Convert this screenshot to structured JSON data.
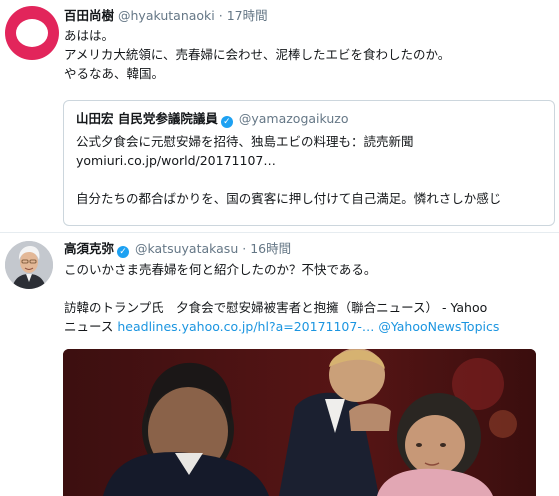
{
  "tweet1": {
    "name": "百田尚樹",
    "handle": "@hyakutanaoki",
    "separator": "·",
    "time": "17時間",
    "lines": [
      "あはは。",
      "アメリカ大統領に、売春婦に会わせ、泥棒したエビを食わしたのか。",
      "やるなあ、韓国。"
    ],
    "quote": {
      "name": "山田宏 自民党参議院議員",
      "handle": "@yamazogaikuzo",
      "line1": "公式夕食会に元慰安婦を招待、独島エビの料理も：読売新聞",
      "line2": "yomiuri.co.jp/world/20171107…",
      "line3": "自分たちの都合ばかりを、国の賓客に押し付けて自己満足。憐れさしか感じ"
    }
  },
  "tweet2": {
    "name": "高須克弥",
    "handle": "@katsuyatakasu",
    "separator": "·",
    "time": "16時間",
    "line1": "このいかさま売春婦を何と紹介したのか？不快である。",
    "line2": "訪韓のトランプ氏　夕食会で慰安婦被害者と抱擁（聯合ニュース） - Yahoo",
    "line3_prefix": "ニュース",
    "link1": "headlines.yahoo.co.jp/hl?a=20171107-…",
    "link2": "@YahooNewsTopics"
  },
  "icons": {
    "verified": "verified-badge-icon"
  },
  "colors": {
    "accent": "#1b95e0",
    "avatar1": "#e2255b",
    "muted": "#657786"
  }
}
